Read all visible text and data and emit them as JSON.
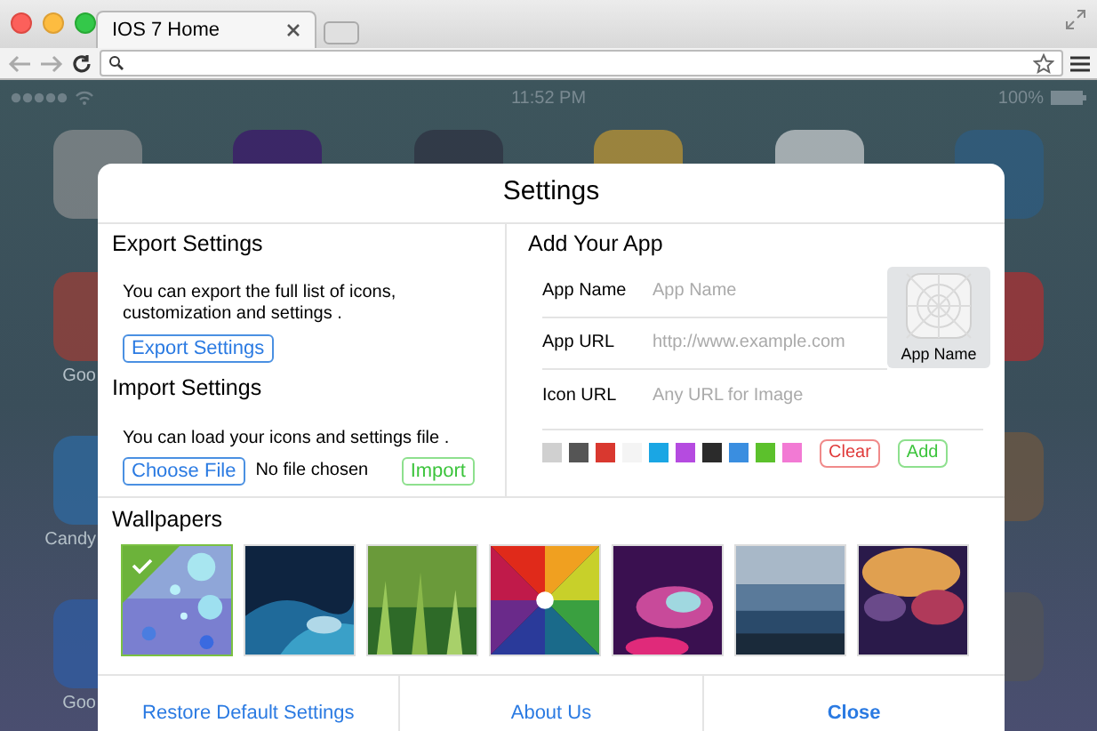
{
  "browser": {
    "tab_title": "IOS 7 Home"
  },
  "status_bar": {
    "time": "11:52 PM",
    "battery": "100%"
  },
  "side_icons": [
    {
      "label": "Goo"
    },
    {
      "label": "Candy"
    },
    {
      "label": "Goo"
    }
  ],
  "settings": {
    "title": "Settings",
    "export": {
      "heading": "Export Settings",
      "description": "You can export the full list of icons, customization and settings .",
      "button": "Export Settings"
    },
    "import": {
      "heading": "Import Settings",
      "description": "You can load your icons and settings file .",
      "choose_button": "Choose File",
      "file_status": "No file chosen",
      "import_button": "Import"
    },
    "add_app": {
      "heading": "Add Your App",
      "fields": [
        {
          "label": "App Name",
          "placeholder": "App Name"
        },
        {
          "label": "App URL",
          "placeholder": "http://www.example.com"
        },
        {
          "label": "Icon URL",
          "placeholder": "Any URL for Image"
        }
      ],
      "preview_label": "App Name",
      "colors": [
        {
          "color": "#d0d0d0"
        },
        {
          "color": "#555555"
        },
        {
          "color": "#d9382f"
        },
        {
          "color": "#f4f4f4"
        },
        {
          "color": "#1aa6e4"
        },
        {
          "color": "#b54be0"
        },
        {
          "color": "#2b2b2b"
        },
        {
          "color": "#3a8ee0"
        },
        {
          "color": "#5cc12c"
        },
        {
          "color": "#f27ad4"
        }
      ],
      "clear_button": "Clear",
      "add_button": "Add"
    },
    "wallpapers": {
      "heading": "Wallpapers",
      "items": [
        {
          "selected": true
        },
        {
          "selected": false
        },
        {
          "selected": false
        },
        {
          "selected": false
        },
        {
          "selected": false
        },
        {
          "selected": false
        },
        {
          "selected": false
        }
      ]
    },
    "footer": [
      {
        "label": "Restore Default Settings",
        "bold": false
      },
      {
        "label": "About Us",
        "bold": false
      },
      {
        "label": "Close",
        "bold": true
      }
    ]
  }
}
